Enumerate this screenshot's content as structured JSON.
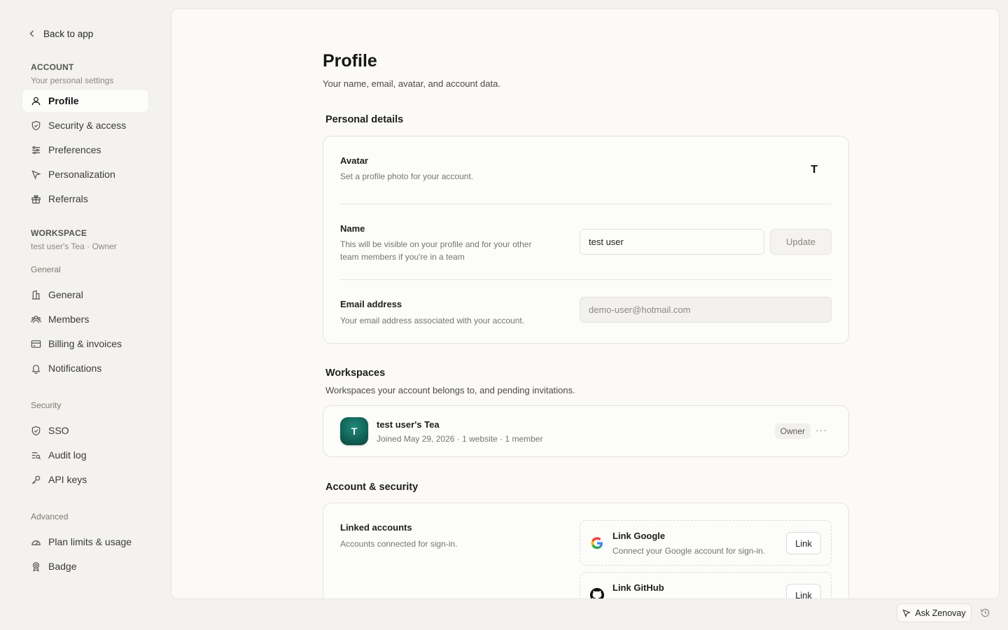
{
  "sidebar": {
    "back_label": "Back to app",
    "account": {
      "title": "ACCOUNT",
      "subtitle": "Your personal settings",
      "items": [
        {
          "label": "Profile",
          "icon": "user-icon"
        },
        {
          "label": "Security & access",
          "icon": "shield-icon"
        },
        {
          "label": "Preferences",
          "icon": "sliders-icon"
        },
        {
          "label": "Personalization",
          "icon": "cursor-icon"
        },
        {
          "label": "Referrals",
          "icon": "gift-icon"
        }
      ]
    },
    "workspace": {
      "title": "WORKSPACE",
      "subtitle": "test user's Tea · Owner",
      "general_label": "General",
      "general_items": [
        {
          "label": "General",
          "icon": "building-icon"
        },
        {
          "label": "Members",
          "icon": "users-icon"
        },
        {
          "label": "Billing & invoices",
          "icon": "credit-card-icon"
        },
        {
          "label": "Notifications",
          "icon": "bell-icon"
        }
      ],
      "security_label": "Security",
      "security_items": [
        {
          "label": "SSO",
          "icon": "shield-check-icon"
        },
        {
          "label": "Audit log",
          "icon": "list-search-icon"
        },
        {
          "label": "API keys",
          "icon": "key-icon"
        }
      ],
      "advanced_label": "Advanced",
      "advanced_items": [
        {
          "label": "Plan limits & usage",
          "icon": "gauge-icon"
        },
        {
          "label": "Badge",
          "icon": "badge-icon"
        }
      ]
    }
  },
  "main": {
    "title": "Profile",
    "subtitle": "Your name, email, avatar, and account data.",
    "personal": {
      "heading": "Personal details",
      "avatar_label": "Avatar",
      "avatar_desc": "Set a profile photo for your account.",
      "avatar_initial": "T",
      "name_label": "Name",
      "name_desc": "This will be visible on your profile and for your other team members if you're in a team",
      "name_value": "test user",
      "update_label": "Update",
      "email_label": "Email address",
      "email_desc": "Your email address associated with your account.",
      "email_value": "demo-user@hotmail.com"
    },
    "workspaces": {
      "heading": "Workspaces",
      "subtitle": "Workspaces your account belongs to, and pending invitations.",
      "item": {
        "initial": "T",
        "name": "test user's Tea",
        "meta": "Joined May 29, 2026 · 1 website · 1 member",
        "role": "Owner",
        "more": "···"
      }
    },
    "account_security": {
      "heading": "Account & security",
      "linked_label": "Linked accounts",
      "linked_desc": "Accounts connected for sign-in.",
      "google": {
        "title": "Link Google",
        "desc": "Connect your Google account for sign-in.",
        "button": "Link"
      },
      "github": {
        "title": "Link GitHub",
        "button": "Link"
      }
    }
  },
  "footer": {
    "ask_label": "Ask Zenovay"
  },
  "colors": {
    "background": "#f3f2ee",
    "panel": "#fbfaf8",
    "workspace_avatar": "#0f5a4f"
  }
}
